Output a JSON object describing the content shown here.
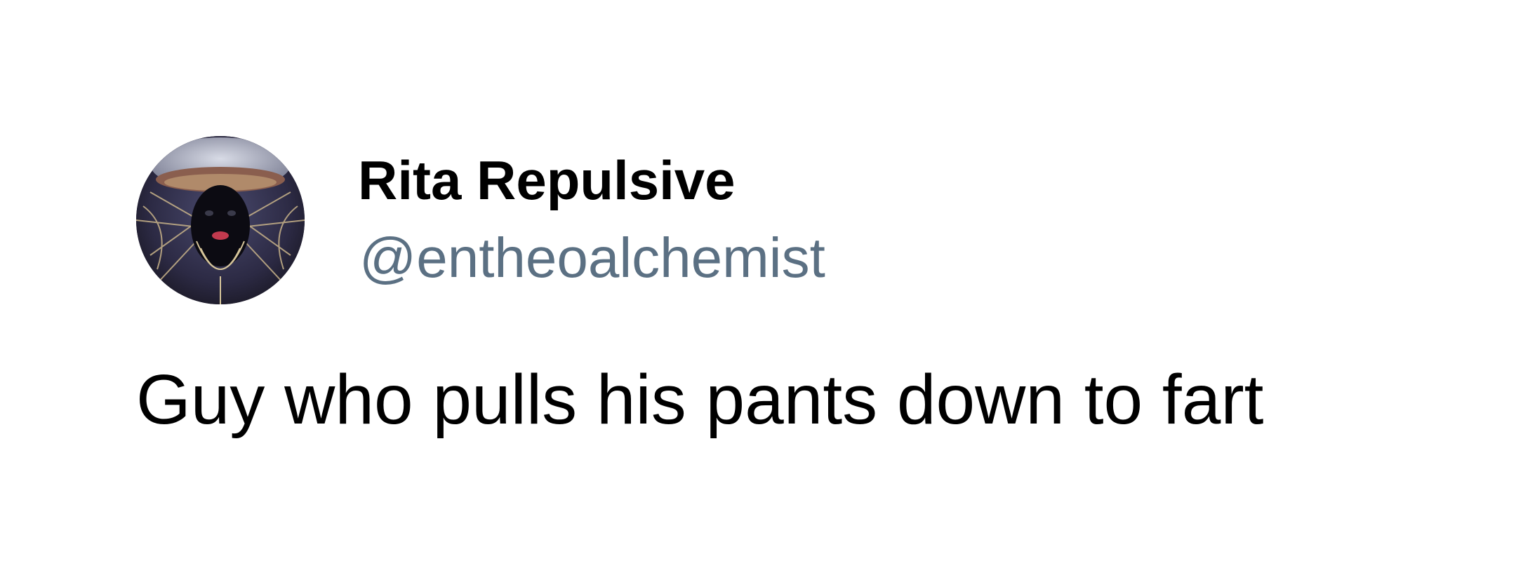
{
  "tweet": {
    "author": {
      "display_name": "Rita Repulsive",
      "handle": "@entheoalchemist",
      "avatar_icon": "profile-avatar"
    },
    "text": "Guy who pulls his pants down to fart",
    "colors": {
      "name": "#000000",
      "handle": "#5b7083",
      "text": "#000000",
      "background": "#ffffff"
    }
  }
}
